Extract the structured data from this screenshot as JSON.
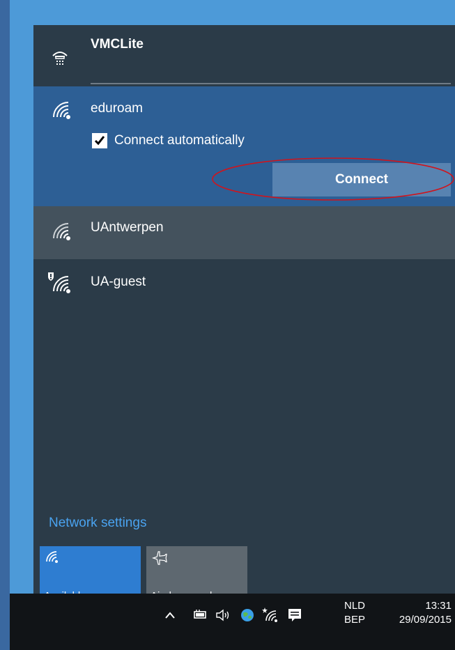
{
  "networks": [
    {
      "name": "VMCLite",
      "icon": "ethernet-phone-icon",
      "state": "connected"
    },
    {
      "name": "eduroam",
      "icon": "wifi-icon",
      "expanded": true,
      "connect_automatically_label": "Connect automatically",
      "connect_automatically_checked": true,
      "connect_label": "Connect"
    },
    {
      "name": "UAntwerpen",
      "icon": "wifi-icon"
    },
    {
      "name": "UA-guest",
      "icon": "wifi-shield-icon"
    }
  ],
  "network_settings_label": "Network settings",
  "quick_actions": [
    {
      "label": "Available",
      "icon": "wifi-icon",
      "active": true
    },
    {
      "label": "Airplane mode",
      "icon": "airplane-icon",
      "active": false
    }
  ],
  "taskbar": {
    "language": "NLD",
    "keyboard": "BEP",
    "time": "13:31",
    "date": "29/09/2015"
  },
  "colors": {
    "panel_bg": "#2b3b48",
    "selected_bg": "#2d5f95",
    "hover_bg": "#44525d",
    "accent": "#2e7dd1",
    "link": "#4aa3f0",
    "annotation": "#d0141c"
  }
}
